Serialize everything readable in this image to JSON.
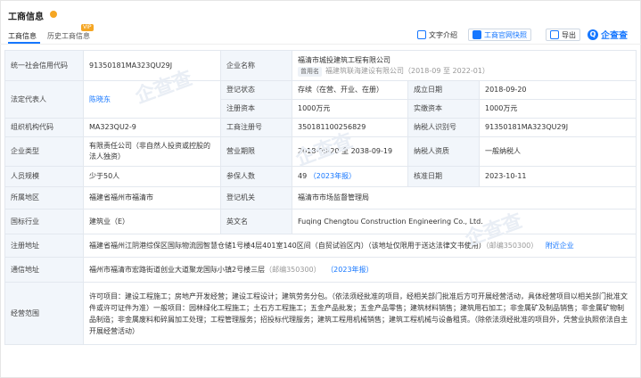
{
  "page_title": "工商信息",
  "tabs": [
    {
      "label": "工商信息"
    },
    {
      "label": "历史工商信息",
      "badge": "VIP"
    }
  ],
  "toolbar": {
    "text_intro": "文字介绍",
    "snapshot": "工商官网快照",
    "export": "导出",
    "logo_text": "企查查",
    "logo_letter": "Q"
  },
  "rows": {
    "credit_code_label": "统一社会信用代码",
    "credit_code": "91350181MA323QU29J",
    "company_name_label": "企业名称",
    "company_name": "福清市城投建筑工程有限公司",
    "former_name_tag": "曾用名",
    "former_name": "福建筑联海建设有限公司（2018-09 至 2022-01）",
    "legal_rep_label": "法定代表人",
    "legal_rep": "陈晓东",
    "status_label": "登记状态",
    "status": "存续（在营、开业、在册）",
    "established_label": "成立日期",
    "established": "2018-09-20",
    "reg_capital_label": "注册资本",
    "reg_capital": "1000万元",
    "paid_capital_label": "实缴资本",
    "paid_capital": "1000万元",
    "org_code_label": "组织机构代码",
    "org_code": "MA323QU2-9",
    "reg_no_label": "工商注册号",
    "reg_no": "350181100256829",
    "taxpayer_id_label": "纳税人识别号",
    "taxpayer_id": "91350181MA323QU29J",
    "company_type_label": "企业类型",
    "company_type": "有限责任公司（非自然人投资或控股的法人独资）",
    "term_label": "营业期限",
    "term": "2018-09-20 至 2038-09-19",
    "taxpayer_qual_label": "纳税人资质",
    "taxpayer_qual": "一般纳税人",
    "staff_size_label": "人员规模",
    "staff_size": "少于50人",
    "insured_label": "参保人数",
    "insured": "49",
    "insured_report": "（2023年报）",
    "approval_date_label": "核准日期",
    "approval_date": "2023-10-11",
    "region_label": "所属地区",
    "region": "福建省福州市福清市",
    "authority_label": "登记机关",
    "authority": "福清市市场监督管理局",
    "industry_label": "国标行业",
    "industry": "建筑业（E）",
    "english_name_label": "英文名",
    "english_name": "Fuqing Chengtou Construction Engineering Co., Ltd.",
    "reg_address_label": "注册地址",
    "reg_address": "福建省福州江阴港综保区国际物流园智慧仓储1号楼4层401室140区间（自贸试验区内）（该地址仅限用于送达法律文书使用）",
    "reg_postcode": "（邮编350300）",
    "nearby": "附近企业",
    "mail_address_label": "通信地址",
    "mail_address": "福州市福清市宏路街道创业大道聚龙国际小镇2号楼三层",
    "mail_postcode": "（邮编350300）",
    "mail_report": "（2023年报）",
    "scope_label": "经营范围",
    "scope": "许可项目：建设工程施工；房地产开发经营；建设工程设计；建筑劳务分包。（依法须经批准的项目，经相关部门批准后方可开展经营活动，具体经营项目以相关部门批准文件或许可证件为准）一般项目：园林绿化工程施工；土石方工程施工；五金产品批发；五金产品零售；建筑材料销售；建筑用石加工；非金属矿及制品销售；非金属矿物制品制造；非金属废料和碎屑加工处理；工程管理服务；招投标代理服务；建筑工程用机械销售；建筑工程机械与设备租赁。（除依法须经批准的项目外，凭营业执照依法自主开展经营活动）"
  },
  "colors": {
    "accent": "#1677ff",
    "label_bg": "#f2f6fb",
    "border": "#e3e8ef",
    "vip": "#f5a623"
  }
}
